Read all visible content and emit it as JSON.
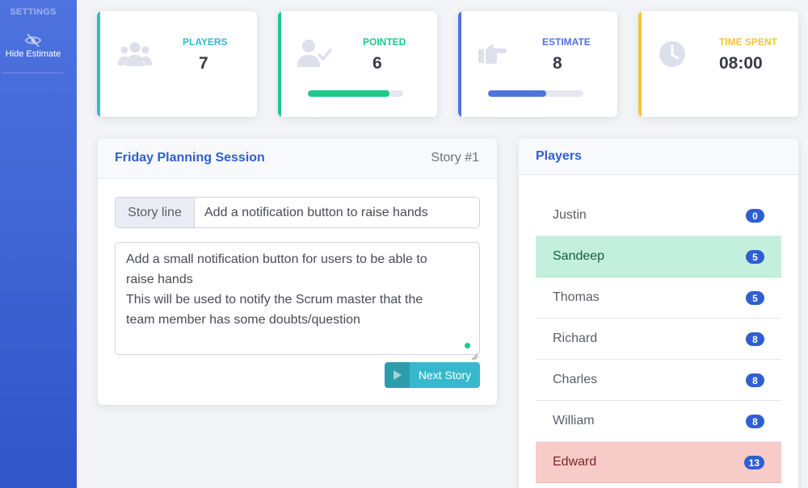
{
  "sidebar": {
    "heading": "SETTINGS",
    "items": [
      {
        "label": "Hide Estimate",
        "icon": "eye-slash-icon"
      }
    ]
  },
  "stats": [
    {
      "label": "PLAYERS",
      "value": "7",
      "icon": "users-icon",
      "color": "#36b9cc"
    },
    {
      "label": "POINTED",
      "value": "6",
      "icon": "user-check-icon",
      "color": "#1cc88a",
      "progress": 0.86
    },
    {
      "label": "ESTIMATE",
      "value": "8",
      "icon": "hand-point-right-icon",
      "color": "#4e73df",
      "progress": 0.61
    },
    {
      "label": "TIME SPENT",
      "value": "08:00",
      "icon": "clock-icon",
      "color": "#f6c23e"
    }
  ],
  "session": {
    "title": "Friday Planning Session",
    "story_number": "Story #1",
    "story_line_label": "Story line",
    "story_line_value": "Add a notification button to raise hands",
    "description_lines": [
      "Add a small notification button for users to be able to",
      "raise hands",
      "This will be used to notify the Scrum master that the",
      "team member has some doubts/question"
    ],
    "next_button_label": "Next Story"
  },
  "players": {
    "title": "Players",
    "list": [
      {
        "name": "Justin",
        "points": "0",
        "status": "none"
      },
      {
        "name": "Sandeep",
        "points": "5",
        "status": "green"
      },
      {
        "name": "Thomas",
        "points": "5",
        "status": "none"
      },
      {
        "name": "Richard",
        "points": "8",
        "status": "none"
      },
      {
        "name": "Charles",
        "points": "8",
        "status": "none"
      },
      {
        "name": "William",
        "points": "8",
        "status": "none"
      },
      {
        "name": "Edward",
        "points": "13",
        "status": "red"
      }
    ]
  }
}
